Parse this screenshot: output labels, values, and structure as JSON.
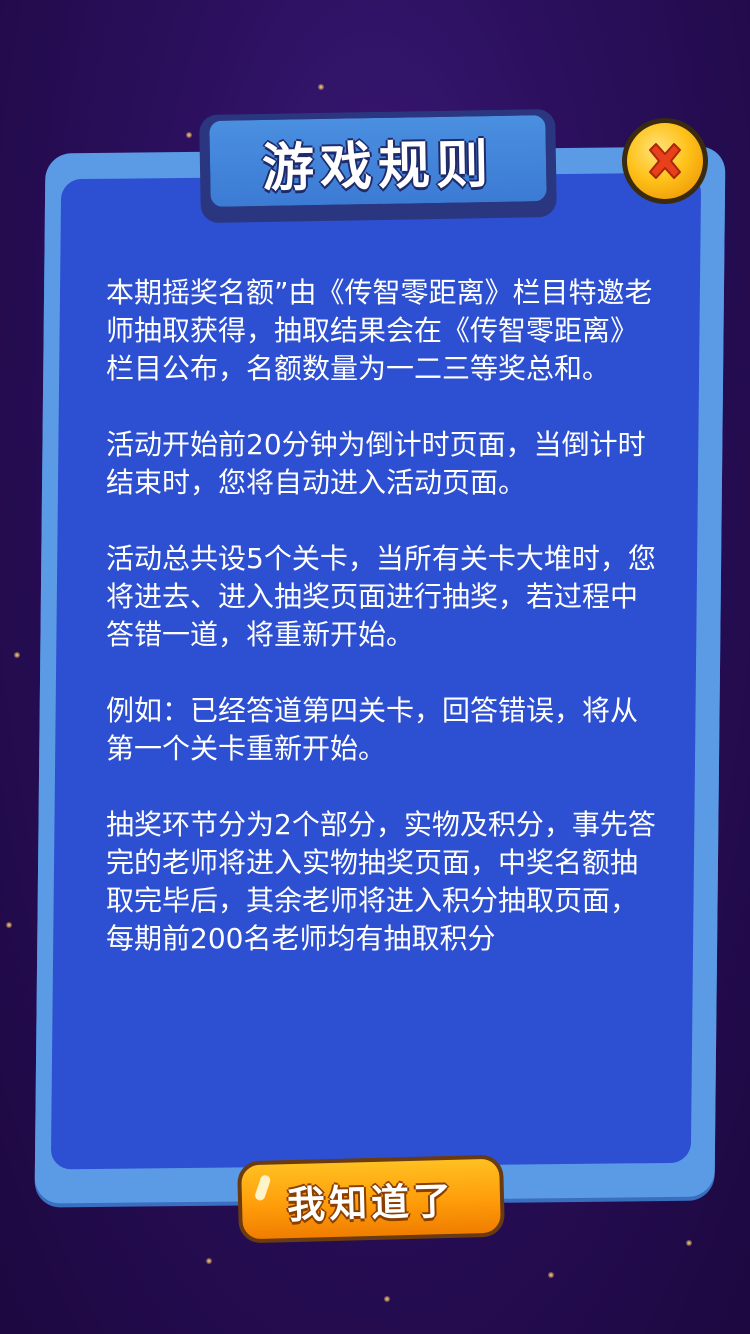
{
  "dialog": {
    "title": "游戏规则",
    "close_icon": "close-x-icon",
    "paragraphs": [
      "本期摇奖名额”由《传智零距离》栏目特邀老师抽取获得，抽取结果会在《传智零距离》栏目公布，名额数量为一二三等奖总和。",
      "活动开始前20分钟为倒计时页面，当倒计时结束时，您将自动进入活动页面。",
      "活动总共设5个关卡，当所有关卡大堆时，您将进去、进入抽奖页面进行抽奖，若过程中答错一道，将重新开始。",
      "例如：已经答道第四关卡，回答错误，将从第一个关卡重新开始。",
      "抽奖环节分为2个部分，实物及积分，事先答完的老师将进入实物抽奖页面，中奖名额抽取完毕后，其余老师将进入积分抽取页面，每期前200名老师均有抽取积分"
    ],
    "confirm_label": "我知道了"
  },
  "colors": {
    "background": "#2a0f5c",
    "panel_border": "#5b9be6",
    "panel_fill": "#2d4fd2",
    "title_fill": "#3c7bd4",
    "button_fill": "#ff9d0a",
    "close_fill": "#ffc21a",
    "close_x": "#e8401a"
  }
}
